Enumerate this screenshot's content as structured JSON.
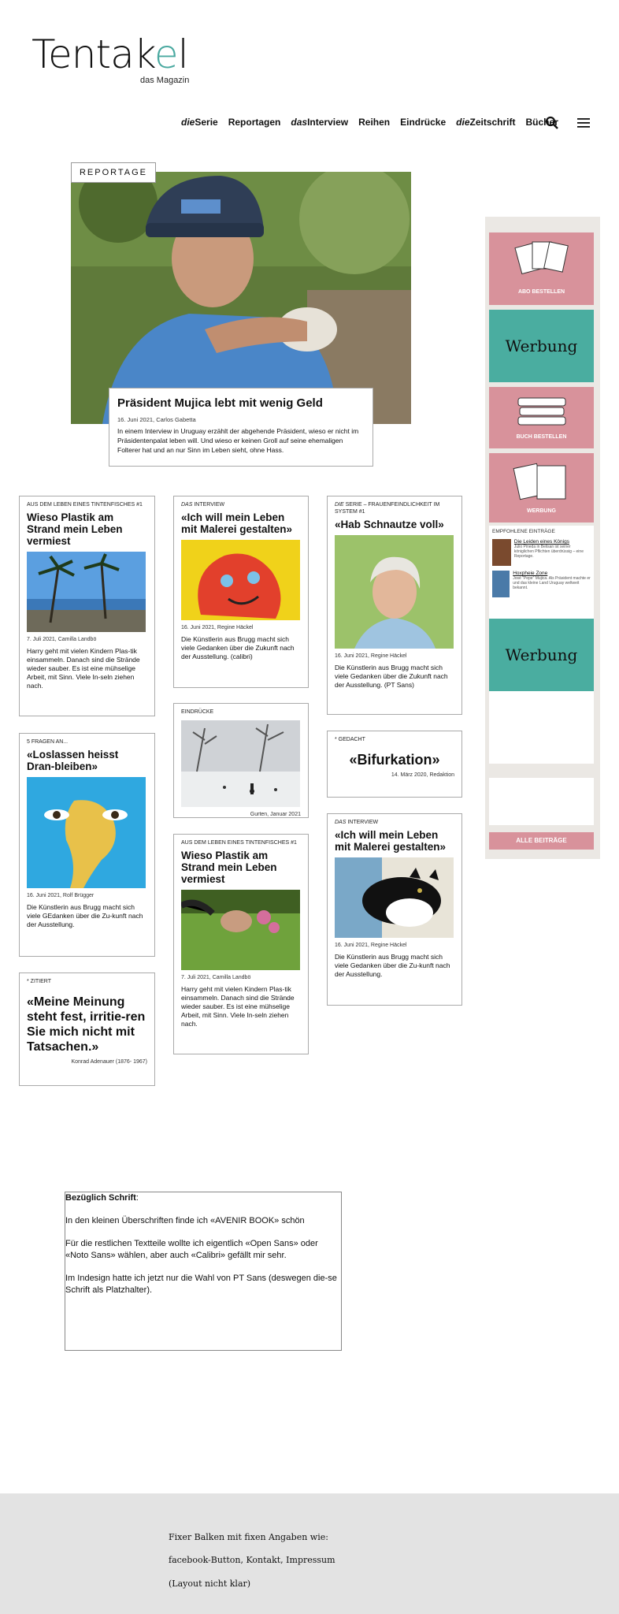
{
  "logo": {
    "text_main": "Tentak",
    "text_k": "e",
    "text_end": "l",
    "subtitle": "das Magazin"
  },
  "nav": {
    "items": [
      {
        "prefix": "die",
        "label": "Serie"
      },
      {
        "prefix": "",
        "label": "Reportagen"
      },
      {
        "prefix": "das",
        "label": "Interview"
      },
      {
        "prefix": "",
        "label": "Reihen"
      },
      {
        "prefix": "",
        "label": "Eindrücke"
      },
      {
        "prefix": "die",
        "label": "Zeitschrift"
      },
      {
        "prefix": "",
        "label": "Bücher"
      }
    ]
  },
  "hero": {
    "tag": "REPORTAGE",
    "title": "Präsident Mujica lebt mit wenig Geld",
    "meta": "16. Juni 2021, Carlos Gabetta",
    "text": "In einem Interview in Uruguay erzählt der abgehende Präsident, wieso er nicht im Präsidentenpalat leben will. Und wieso er keinen Groll auf seine ehemaligen Folterer hat und an nur Sinn im Leben sieht, ohne Hass."
  },
  "cards": {
    "c1": {
      "kicker": "AUS DEM LEBEN EINES TINTENFISCHES  #1",
      "title": "Wieso Plastik am Strand mein Leben vermiest",
      "date": "7. Juli 2021, Camilla Landbö",
      "body": "Harry geht mit vielen Kindern Plas-tik einsammeln. Danach sind die Strände wieder sauber. Es ist eine mühselige Arbeit, mit Sinn. Viele In-seln ziehen nach."
    },
    "c2": {
      "kicker": "5 FRAGEN AN...",
      "title": "«Loslassen heisst Dran-bleiben»",
      "date": "16. Juni 2021, Rolf Brügger",
      "body": "Die Künstlerin aus Brugg macht sich viele GEdanken über die Zu-kunft nach der Ausstellung."
    },
    "c3": {
      "kicker": "* ZITIERT",
      "title": "«Meine Meinung steht fest, irritie-ren Sie mich nicht mit Tatsachen.»",
      "author": "Konrad Adenauer (1876- 1967)"
    },
    "c4": {
      "kicker_pre": "DAS",
      "kicker": " INTERVIEW",
      "title": "«Ich will mein Leben mit Malerei gestalten»",
      "date": "16. Juni 2021, Regine Häckel",
      "body": "Die Künstlerin aus Brugg macht sich viele Gedanken über die Zukunft nach der Ausstellung. (calibri)"
    },
    "c5": {
      "kicker": "EINDRÜCKE",
      "caption": "Gurten, Januar 2021"
    },
    "c6": {
      "kicker": "AUS DEM LEBEN EINES TINTENFISCHES  #1",
      "title": "Wieso Plastik am Strand mein Leben vermiest",
      "date": "7. Juli 2021, Camilla Landbö",
      "body": "Harry geht mit vielen Kindern Plas-tik einsammeln. Danach sind die Strände wieder sauber. Es ist eine mühselige Arbeit, mit Sinn. Viele In-seln ziehen nach."
    },
    "c7": {
      "kicker_pre": "DIE",
      "kicker": " SERIE – FRAUENFEINDLICHKEIT IM SYSTEM  #1",
      "title": "«Hab Schnautze voll»",
      "date": "16. Juni 2021, Regine Häckel",
      "body": "Die Künstlerin aus Brugg macht sich viele Gedanken über die Zukunft nach der Ausstellung. (PT Sans)"
    },
    "c8": {
      "kicker": "* GEDACHT",
      "title": "«Bifurkation»",
      "date": "14. März 2020, Redaktion"
    },
    "c9": {
      "kicker_pre": "DAS",
      "kicker": " INTERVIEW",
      "title": "«Ich will mein Leben mit Malerei gestalten»",
      "date": "16. Juni 2021, Regine Häckel",
      "body": "Die Künstlerin aus Brugg macht sich viele Gedanken über die Zu-kunft nach der Ausstellung."
    }
  },
  "sidebar": {
    "abo": "ABO BESTELLEN",
    "werbung1": "Werbung",
    "buch": "BUCH BESTELLEN",
    "werbung_small": "WERBUNG",
    "recommended_title": "EMPFOHLENE EINTRÄGE",
    "rec1_title": "Die Leiden eines Königs",
    "rec1_text": "Julio Pineda in Belisan ist seiner königlichen Pflichten überdrüssig – eine Reportage.",
    "rec2_title": "Hoxpheie Zone",
    "rec2_text": "José \"Pepe\" Mujica. Als Präsident machte er und das kleine Land Uruguay weltweit bekannt.",
    "werbung2": "Werbung",
    "all": "ALLE BEITRÄGE"
  },
  "note": {
    "p1_bold": "Bezüglich Schrift",
    "p1_rest": ":",
    "p2": "In den kleinen Überschriften finde ich «AVENIR BOOK» schön",
    "p3": "Für die restlichen Textteile wollte ich eigentlich «Open Sans» oder «Noto Sans» wählen, aber auch «Calibri» gefällt mir sehr.",
    "p4": "Im Indesign hatte ich jetzt nur die Wahl von PT Sans (deswegen die-se Schrift als Platzhalter)."
  },
  "footer": {
    "l1": "Fixer Balken mit fixen Angaben wie:",
    "l2": "facebook-Button, Kontakt, Impressum",
    "l3": "(Layout nicht klar)"
  },
  "colors": {
    "accent": "#4aa9a0",
    "pink": "#d8929b",
    "sidebar_bg": "#ebe8e4",
    "footer_bg": "#e3e3e3"
  }
}
